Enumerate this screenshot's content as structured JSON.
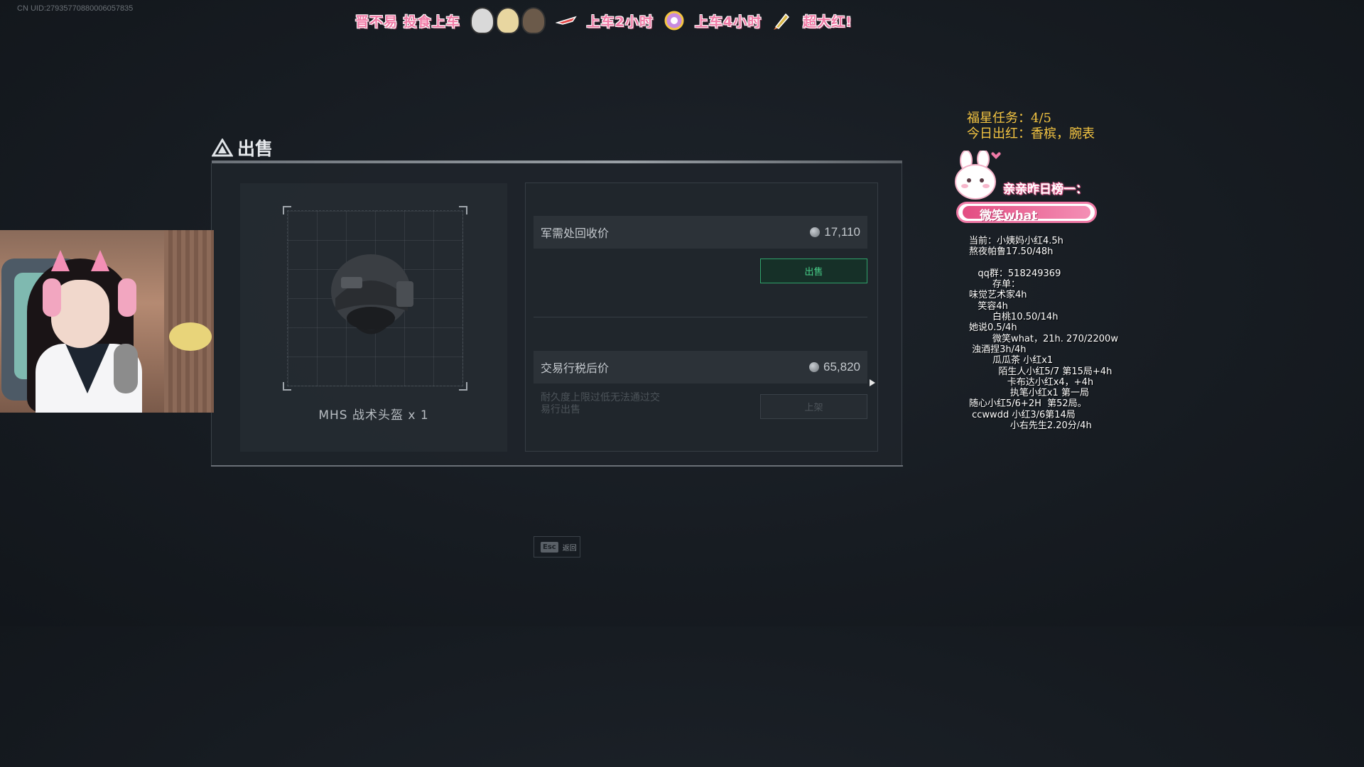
{
  "uid_label": "CN UID:27935770880006057835",
  "banner": {
    "left_text": "晋不易 投食上车",
    "ride_2h": "上车2小时",
    "ride_4h": "上车4小时",
    "big_red": "超大红!"
  },
  "sell_panel": {
    "title": "出售",
    "item_name": "MHS 战术头盔 x 1",
    "recycle_label": "军需处回收价",
    "recycle_price": "17,110",
    "sell_button": "出售",
    "trade_label": "交易行税后价",
    "trade_price": "65,820",
    "durability_note": "耐久度上限过低无法通过交易行出售",
    "list_button": "上架",
    "esc_key": "Esc",
    "esc_label": "返回"
  },
  "overlay": {
    "task_line1": "福星任务：4/5",
    "task_line2": "今日出红：香槟，腕表",
    "yesterday_label": "亲亲昨日榜一：",
    "top_name": "微笑what",
    "stats_lines": "当前：小姨妈小红4.5h\n熬夜帕鲁17.50/48h\n\n   qq群：518249369\n        存单：\n味觉艺术家4h\n   笑容4h\n        白桃10.50/14h\n她说0.5/4h\n        微笑what，21h. 270/2200w\n 浊酒捏3h/4h\n        瓜瓜茶 小红x1\n          陌生人小红5/7 第15局+4h\n             卡布达小红x4，+4h\n              执笔小红x1 第一局\n随心小红5/6+2H  第52局。\n ccwwdd 小红3/6第14局\n              小右先生2.20分/4h"
  },
  "colors": {
    "sell_green": "#48d08a",
    "task_yellow": "#f4c542",
    "pink": "#f07aa6"
  }
}
